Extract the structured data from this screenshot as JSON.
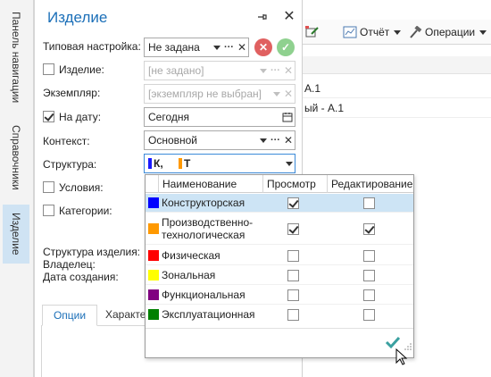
{
  "sidebar": {
    "tabs": [
      {
        "label": "Панель навигации"
      },
      {
        "label": "Справочники"
      },
      {
        "label": "Изделие"
      }
    ]
  },
  "background": {
    "toolbar": {
      "report_label": "Отчёт",
      "operations_label": "Операции"
    },
    "rows": [
      "А.1",
      "ый - А.1"
    ]
  },
  "panel": {
    "title": "Изделие",
    "fields": {
      "preset": {
        "label": "Типовая настройка:",
        "value": "Не задана"
      },
      "item": {
        "label": "Изделие:",
        "value": "[не задано]"
      },
      "instance": {
        "label": "Экземпляр:",
        "value": "[экземпляр не выбран]"
      },
      "date": {
        "label": "На дату:",
        "value": "Сегодня"
      },
      "context": {
        "label": "Контекст:",
        "value": "Основной"
      },
      "structure": {
        "label": "Структура:",
        "chip1": "К,",
        "chip2": "Т",
        "chip1_color": "#1a1aff",
        "chip2_color": "#ff9900"
      },
      "conditions": {
        "label": "Условия:"
      },
      "categories": {
        "label": "Категории:"
      }
    },
    "info": {
      "structure_label": "Структура изделия:",
      "owner_label": "Владелец:",
      "created_label": "Дата создания:"
    },
    "tabs": [
      {
        "label": "Опции"
      },
      {
        "label": "Характе"
      }
    ]
  },
  "popup": {
    "headers": {
      "name": "Наименование",
      "view": "Просмотр",
      "edit": "Редактирование"
    },
    "rows": [
      {
        "name": "Конструкторская",
        "color": "#0000ff",
        "view": true,
        "edit": false
      },
      {
        "name1": "Производственно-",
        "name2": "технологическая",
        "color": "#ff9900",
        "view": true,
        "edit": true
      },
      {
        "name": "Физическая",
        "color": "#ff0000",
        "view": false,
        "edit": false
      },
      {
        "name": "Зональная",
        "color": "#ffff00",
        "view": false,
        "edit": false
      },
      {
        "name": "Функциональная",
        "color": "#800080",
        "view": false,
        "edit": false
      },
      {
        "name": "Эксплуатационная",
        "color": "#008000",
        "view": false,
        "edit": false
      }
    ]
  },
  "colors": {
    "accent": "#1b6fb8",
    "selected_row": "#cde4f5",
    "cancel_red": "#e06060",
    "apply_green": "#6cc070"
  }
}
